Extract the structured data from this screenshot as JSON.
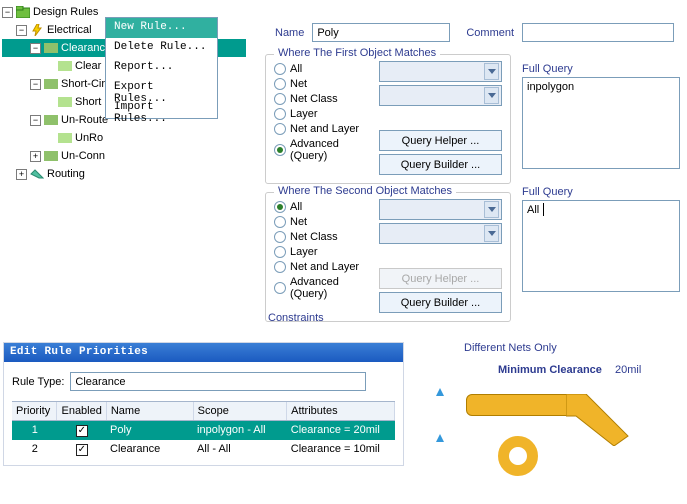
{
  "tree": {
    "root": "Design Rules",
    "electrical": "Electrical",
    "clearance_group": "Clearance",
    "clearance_rule": "Clear",
    "short": "Short-Circ",
    "short_item": "Short",
    "unroute": "Un-Route",
    "unroute_item": "UnRo",
    "unconn": "Un-Conn",
    "routing": "Routing"
  },
  "contextMenu": {
    "new": "New Rule...",
    "delete": "Delete Rule...",
    "report": "Report...",
    "export": "Export Rules...",
    "import": "Import Rules..."
  },
  "form": {
    "name_label": "Name",
    "name_value": "Poly",
    "comment_label": "Comment",
    "comment_value": ""
  },
  "match1": {
    "legend": "Where The First Object Matches",
    "opt_all": "All",
    "opt_net": "Net",
    "opt_netclass": "Net Class",
    "opt_layer": "Layer",
    "opt_netlayer": "Net and Layer",
    "opt_adv": "Advanced (Query)",
    "btn_helper": "Query Helper ...",
    "btn_builder": "Query Builder ..."
  },
  "match2": {
    "legend": "Where The Second Object Matches",
    "opt_all": "All",
    "opt_net": "Net",
    "opt_netclass": "Net Class",
    "opt_layer": "Layer",
    "opt_netlayer": "Net and Layer",
    "opt_adv": "Advanced (Query)",
    "btn_helper": "Query Helper ...",
    "btn_builder": "Query Builder ..."
  },
  "fullQuery": {
    "label": "Full Query",
    "q1": "inpolygon",
    "q2": "All"
  },
  "constraints_label": "Constraints",
  "priorities": {
    "title": "Edit Rule Priorities",
    "ruletype_label": "Rule Type:",
    "ruletype_value": "Clearance",
    "headers": {
      "priority": "Priority",
      "enabled": "Enabled",
      "name": "Name",
      "scope": "Scope",
      "attributes": "Attributes"
    },
    "rows": [
      {
        "priority": "1",
        "enabled": true,
        "name": "Poly",
        "scope": "inpolygon   -   All",
        "attributes": "Clearance = 20mil"
      },
      {
        "priority": "2",
        "enabled": true,
        "name": "Clearance",
        "scope": "All   -   All",
        "attributes": "Clearance = 10mil"
      }
    ]
  },
  "diagram": {
    "text1": "Different Nets Only",
    "text2": "Minimum Clearance",
    "value": "20mil"
  }
}
